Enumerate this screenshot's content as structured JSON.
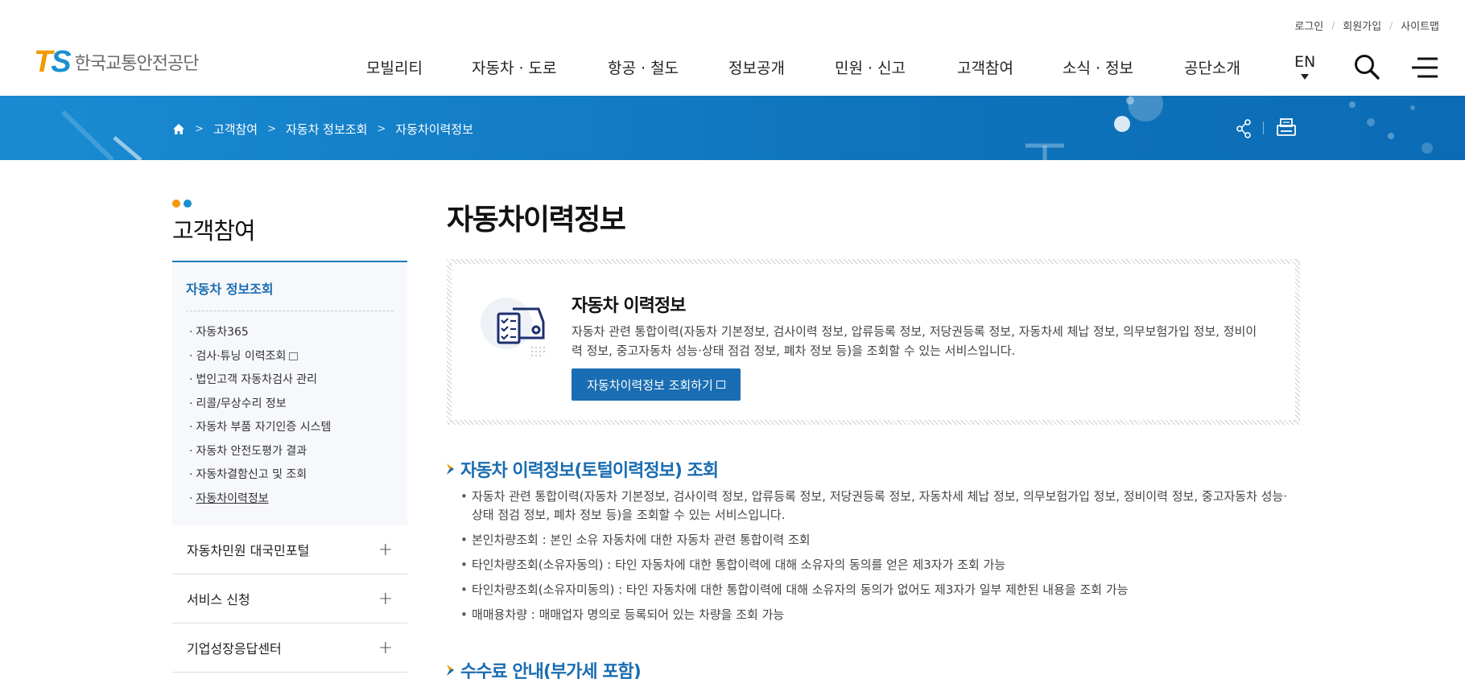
{
  "header": {
    "util_links": [
      "로그인",
      "회원가입",
      "사이트맵"
    ],
    "logo_mark_t": "T",
    "logo_mark_s": "S",
    "logo_name": "한국교통안전공단",
    "gnb": [
      "모빌리티",
      "자동차 · 도로",
      "항공 · 철도",
      "정보공개",
      "민원 · 신고",
      "고객참여",
      "소식 · 정보",
      "공단소개"
    ],
    "lang": "EN"
  },
  "breadcrumb": [
    "고객참여",
    "자동차 정보조회",
    "자동차이력정보"
  ],
  "lnb": {
    "title": "고객참여",
    "active_group": "자동차 정보조회",
    "items": [
      "자동차365",
      "검사·튜닝 이력조회",
      "법인고객 자동차검사 관리",
      "리콜/무상수리 정보",
      "자동차 부품 자기인증 시스템",
      "자동차 안전도평가 결과",
      "자동차결함신고 및 조회",
      "자동차이력정보"
    ],
    "item_bullet": "·",
    "groups": [
      "자동차민원 대국민포털",
      "서비스 신청",
      "기업성장응답센터"
    ],
    "plus_symbol": "+"
  },
  "content": {
    "title": "자동차이력정보",
    "box_title": "자동차 이력정보",
    "box_desc": "자동차 관련 통합이력(자동차 기본정보, 검사이력 정보, 압류등록 정보, 저당권등록 정보, 자동차세 체납 정보, 의무보험가입 정보, 정비이력 정보, 중고자동차 성능·상태 점검 정보, 폐차 정보 등)을 조회할 수 있는 서비스입니다.",
    "box_button": "자동차이력정보 조회하기",
    "section1_title": "자동차 이력정보(토털이력정보) 조회",
    "section1_items": [
      "자동차 관련 통합이력(자동차 기본정보, 검사이력 정보, 압류등록 정보, 저당권등록 정보, 자동차세 체납 정보, 의무보험가입 정보, 정비이력 정보, 중고자동차 성능·상태 점검 정보, 폐차 정보 등)을 조회할 수 있는 서비스입니다.",
      "본인차량조회 : 본인 소유 자동차에 대한 자동차 관련 통합이력 조회",
      "타인차량조회(소유자동의) : 타인 자동차에 대한 통합이력에 대해 소유자의 동의를 얻은 제3자가 조회 가능",
      "타인차량조회(소유자미동의) : 타인 자동차에 대한 통합이력에 대해 소유자의 동의가 없어도 제3자가 일부 제한된 내용을 조회 가능",
      "매매용차량 : 매매업자 명의로 등록되어 있는 차량을 조회 가능"
    ],
    "section2_title": "수수료 안내(부가세 포함)"
  },
  "colors": {
    "brand_blue": "#1a6db2",
    "brand_orange": "#f39800",
    "banner_blue": "#0e74bc"
  }
}
